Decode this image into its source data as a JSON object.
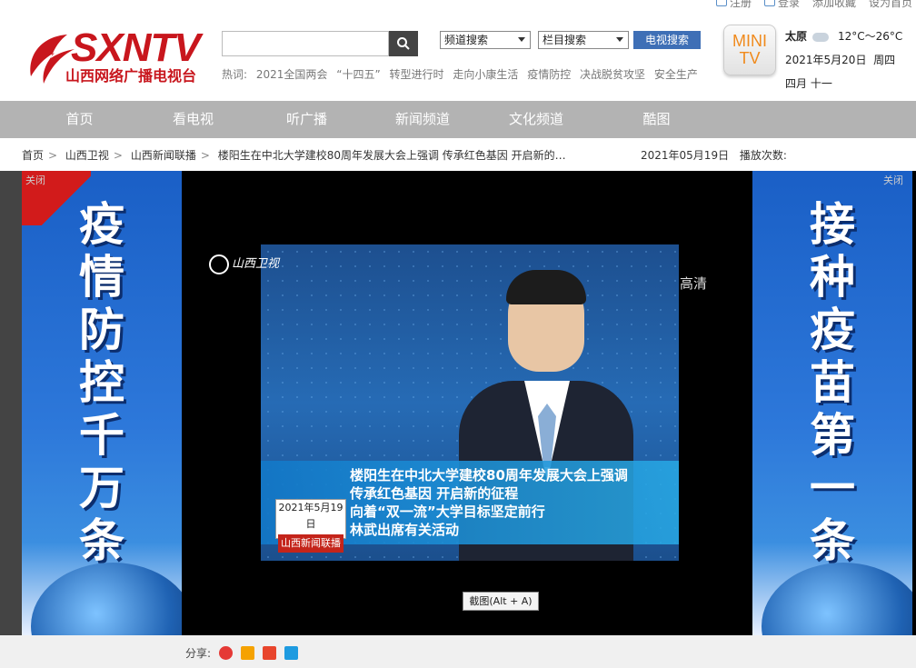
{
  "util": {
    "register": "注册",
    "login": "登录",
    "bookmark": "添加收藏",
    "home": "设为首页"
  },
  "logo": {
    "big": "SXNTV",
    "small": "山西网络广播电视台"
  },
  "search": {
    "placeholder": ""
  },
  "hot": {
    "label": "热词:",
    "items": [
      "2021全国两会",
      "“十四五”",
      "转型进行时",
      "走向小康生活",
      "疫情防控",
      "决战脱贫攻坚",
      "安全生产"
    ]
  },
  "selects": {
    "channel": "频道搜索",
    "column": "栏目搜索",
    "tvsearch": "电视搜索"
  },
  "minitv": {
    "line1": "MINI",
    "line2": "TV"
  },
  "weather": {
    "city": "太原",
    "temp": "12°C～26°C",
    "date": "2021年5月20日",
    "weekday": "周四",
    "lunar": "四月  十一"
  },
  "nav": [
    "首页",
    "看电视",
    "听广播",
    "新闻频道",
    "文化频道",
    "酷图"
  ],
  "crumb": {
    "items": [
      "首页",
      "山西卫视",
      "山西新闻联播"
    ],
    "title": "楼阳生在中北大学建校80周年发展大会上强调 传承红色基因 开启新的…",
    "date": "2021年05月19日",
    "plays": "播放次数:"
  },
  "banner_left": {
    "text": "疫情防控千万条",
    "close": "关闭"
  },
  "banner_right": {
    "text": "接种疫苗第一条",
    "close": "关闭"
  },
  "video": {
    "channel": "山西卫视",
    "hd": "高清",
    "caption": [
      "楼阳生在中北大学建校80周年发展大会上强调",
      "传承红色基因  开启新的征程",
      "向着“双一流”大学目标坚定前行",
      "林武出席有关活动"
    ],
    "date": "2021年5月19日",
    "program": "山西新闻联播"
  },
  "screenshot_btn": "截图(Alt + A)",
  "share": {
    "label": "分享:"
  },
  "colors": {
    "brand": "#c8161d",
    "nav": "#b3b3b3",
    "accent": "#3e6fb6"
  }
}
